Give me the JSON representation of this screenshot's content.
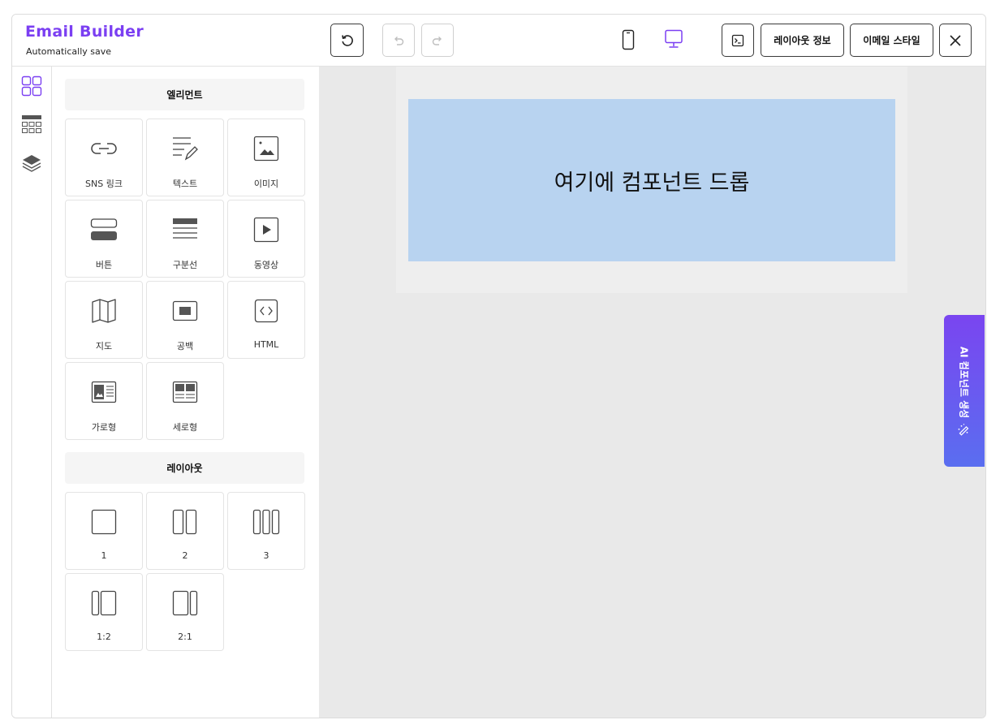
{
  "header": {
    "title": "Email Builder",
    "subtitle": "Automatically save",
    "layout_info_label": "레이아웃 정보",
    "email_style_label": "이메일 스타일",
    "accent_color": "#7b3ff2"
  },
  "elements_section": {
    "title": "엘리먼트",
    "items": [
      {
        "label": "SNS 링크",
        "icon": "link-icon"
      },
      {
        "label": "텍스트",
        "icon": "text-edit-icon"
      },
      {
        "label": "이미지",
        "icon": "image-icon"
      },
      {
        "label": "버튼",
        "icon": "button-icon"
      },
      {
        "label": "구분선",
        "icon": "divider-icon"
      },
      {
        "label": "동영상",
        "icon": "video-icon"
      },
      {
        "label": "지도",
        "icon": "map-icon"
      },
      {
        "label": "공백",
        "icon": "spacer-icon"
      },
      {
        "label": "HTML",
        "icon": "code-icon"
      },
      {
        "label": "가로형",
        "icon": "horizontal-card-icon"
      },
      {
        "label": "세로형",
        "icon": "vertical-card-icon"
      }
    ]
  },
  "layout_section": {
    "title": "레이아웃",
    "items": [
      {
        "label": "1",
        "icon": "one-column-icon"
      },
      {
        "label": "2",
        "icon": "two-column-icon"
      },
      {
        "label": "3",
        "icon": "three-column-icon"
      },
      {
        "label": "1:2",
        "icon": "one-two-column-icon"
      },
      {
        "label": "2:1",
        "icon": "two-one-column-icon"
      }
    ]
  },
  "canvas": {
    "drop_text": "여기에 컴포넌트 드롭",
    "drop_color": "#b8d3f0"
  },
  "ai_tab": {
    "label": "AI 컴포넌트 생성"
  }
}
